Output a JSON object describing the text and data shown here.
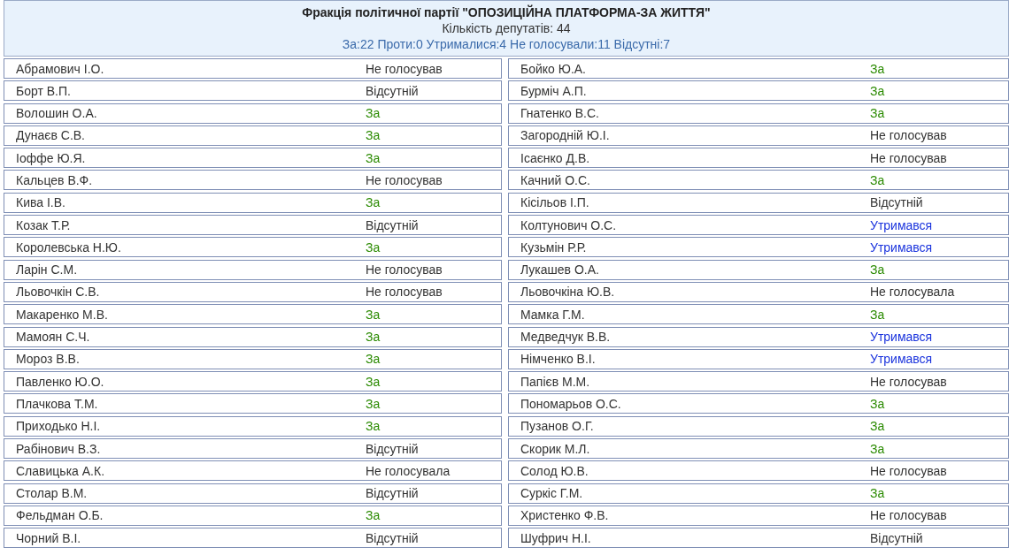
{
  "faction": {
    "title": "Фракція політичної партії \"ОПОЗИЦІЙНА ПЛАТФОРМА-ЗА ЖИТТЯ\"",
    "count": "Кількість депутатів: 44",
    "summary": "За:22 Проти:0 Утрималися:4 Не голосували:11 Відсутні:7"
  },
  "deputies": [
    {
      "name": "Абрамович І.О.",
      "vote": "Не голосував",
      "kind": "not_voted"
    },
    {
      "name": "Бойко Ю.А.",
      "vote": "За",
      "kind": "for"
    },
    {
      "name": "Борт В.П.",
      "vote": "Відсутній",
      "kind": "absent"
    },
    {
      "name": "Бурміч А.П.",
      "vote": "За",
      "kind": "for"
    },
    {
      "name": "Волошин О.А.",
      "vote": "За",
      "kind": "for"
    },
    {
      "name": "Гнатенко В.С.",
      "vote": "За",
      "kind": "for"
    },
    {
      "name": "Дунаєв С.В.",
      "vote": "За",
      "kind": "for"
    },
    {
      "name": "Загородній Ю.І.",
      "vote": "Не голосував",
      "kind": "not_voted"
    },
    {
      "name": "Іоффе Ю.Я.",
      "vote": "За",
      "kind": "for"
    },
    {
      "name": "Ісаєнко Д.В.",
      "vote": "Не голосував",
      "kind": "not_voted"
    },
    {
      "name": "Кальцев В.Ф.",
      "vote": "Не голосував",
      "kind": "not_voted"
    },
    {
      "name": "Качний О.С.",
      "vote": "За",
      "kind": "for"
    },
    {
      "name": "Кива І.В.",
      "vote": "За",
      "kind": "for"
    },
    {
      "name": "Кісільов І.П.",
      "vote": "Відсутній",
      "kind": "absent"
    },
    {
      "name": "Козак Т.Р.",
      "vote": "Відсутній",
      "kind": "absent"
    },
    {
      "name": "Колтунович О.С.",
      "vote": "Утримався",
      "kind": "abstained"
    },
    {
      "name": "Королевська Н.Ю.",
      "vote": "За",
      "kind": "for"
    },
    {
      "name": "Кузьмін Р.Р.",
      "vote": "Утримався",
      "kind": "abstained"
    },
    {
      "name": "Ларін С.М.",
      "vote": "Не голосував",
      "kind": "not_voted"
    },
    {
      "name": "Лукашев О.А.",
      "vote": "За",
      "kind": "for"
    },
    {
      "name": "Льовочкін С.В.",
      "vote": "Не голосував",
      "kind": "not_voted"
    },
    {
      "name": "Льовочкіна Ю.В.",
      "vote": "Не голосувала",
      "kind": "not_voted"
    },
    {
      "name": "Макаренко М.В.",
      "vote": "За",
      "kind": "for"
    },
    {
      "name": "Мамка Г.М.",
      "vote": "За",
      "kind": "for"
    },
    {
      "name": "Мамоян С.Ч.",
      "vote": "За",
      "kind": "for"
    },
    {
      "name": "Медведчук В.В.",
      "vote": "Утримався",
      "kind": "abstained"
    },
    {
      "name": "Мороз В.В.",
      "vote": "За",
      "kind": "for"
    },
    {
      "name": "Німченко В.І.",
      "vote": "Утримався",
      "kind": "abstained"
    },
    {
      "name": "Павленко Ю.О.",
      "vote": "За",
      "kind": "for"
    },
    {
      "name": "Папієв М.М.",
      "vote": "Не голосував",
      "kind": "not_voted"
    },
    {
      "name": "Плачкова Т.М.",
      "vote": "За",
      "kind": "for"
    },
    {
      "name": "Пономарьов О.С.",
      "vote": "За",
      "kind": "for"
    },
    {
      "name": "Приходько Н.І.",
      "vote": "За",
      "kind": "for"
    },
    {
      "name": "Пузанов О.Г.",
      "vote": "За",
      "kind": "for"
    },
    {
      "name": "Рабінович В.З.",
      "vote": "Відсутній",
      "kind": "absent"
    },
    {
      "name": "Скорик М.Л.",
      "vote": "За",
      "kind": "for"
    },
    {
      "name": "Славицька А.К.",
      "vote": "Не голосувала",
      "kind": "not_voted"
    },
    {
      "name": "Солод Ю.В.",
      "vote": "Не голосував",
      "kind": "not_voted"
    },
    {
      "name": "Столар В.М.",
      "vote": "Відсутній",
      "kind": "absent"
    },
    {
      "name": "Суркіс Г.М.",
      "vote": "За",
      "kind": "for"
    },
    {
      "name": "Фельдман О.Б.",
      "vote": "За",
      "kind": "for"
    },
    {
      "name": "Христенко Ф.В.",
      "vote": "Не голосував",
      "kind": "not_voted"
    },
    {
      "name": "Чорний В.І.",
      "vote": "Відсутній",
      "kind": "absent"
    },
    {
      "name": "Шуфрич Н.І.",
      "vote": "Відсутній",
      "kind": "absent"
    }
  ]
}
